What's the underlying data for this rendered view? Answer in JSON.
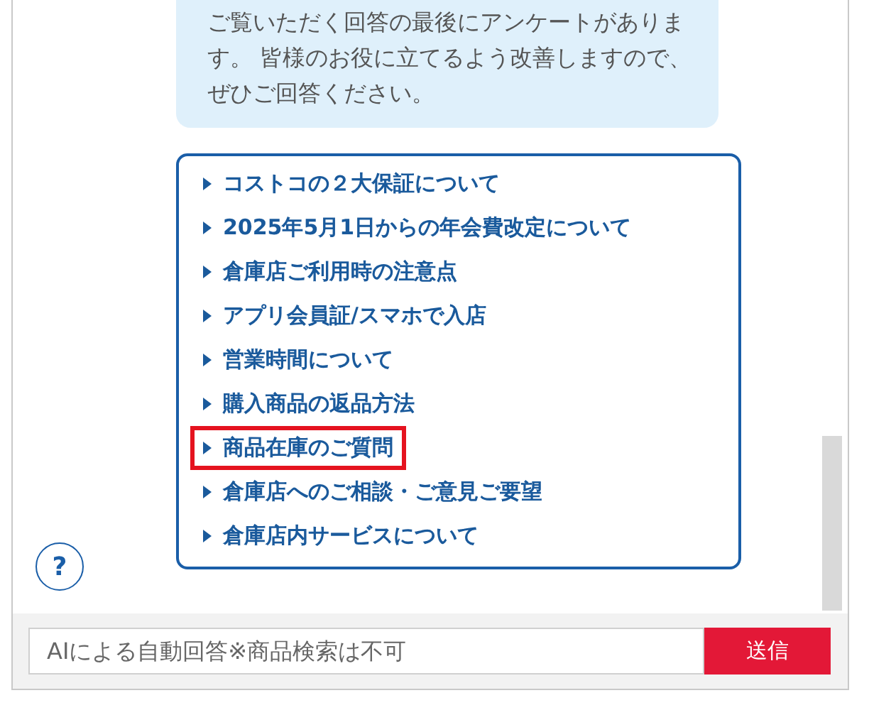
{
  "message": {
    "text": "ご覧いただく回答の最後にアンケートがあります。 皆様のお役に立てるよう改善しますので、ぜひご回答ください。"
  },
  "menu": {
    "items": [
      {
        "label": "コストコの２大保証について",
        "highlighted": false
      },
      {
        "label": "2025年5月1日からの年会費改定について",
        "highlighted": false
      },
      {
        "label": "倉庫店ご利用時の注意点",
        "highlighted": false
      },
      {
        "label": "アプリ会員証/スマホで入店",
        "highlighted": false
      },
      {
        "label": "営業時間について",
        "highlighted": false
      },
      {
        "label": "購入商品の返品方法",
        "highlighted": false
      },
      {
        "label": "商品在庫のご質問",
        "highlighted": true
      },
      {
        "label": "倉庫店へのご相談・ご意見ご要望",
        "highlighted": false
      },
      {
        "label": "倉庫店内サービスについて",
        "highlighted": false
      }
    ]
  },
  "help": {
    "label": "?"
  },
  "input": {
    "placeholder": "AIによる自動回答※商品検索は不可"
  },
  "send_button": {
    "label": "送信"
  }
}
